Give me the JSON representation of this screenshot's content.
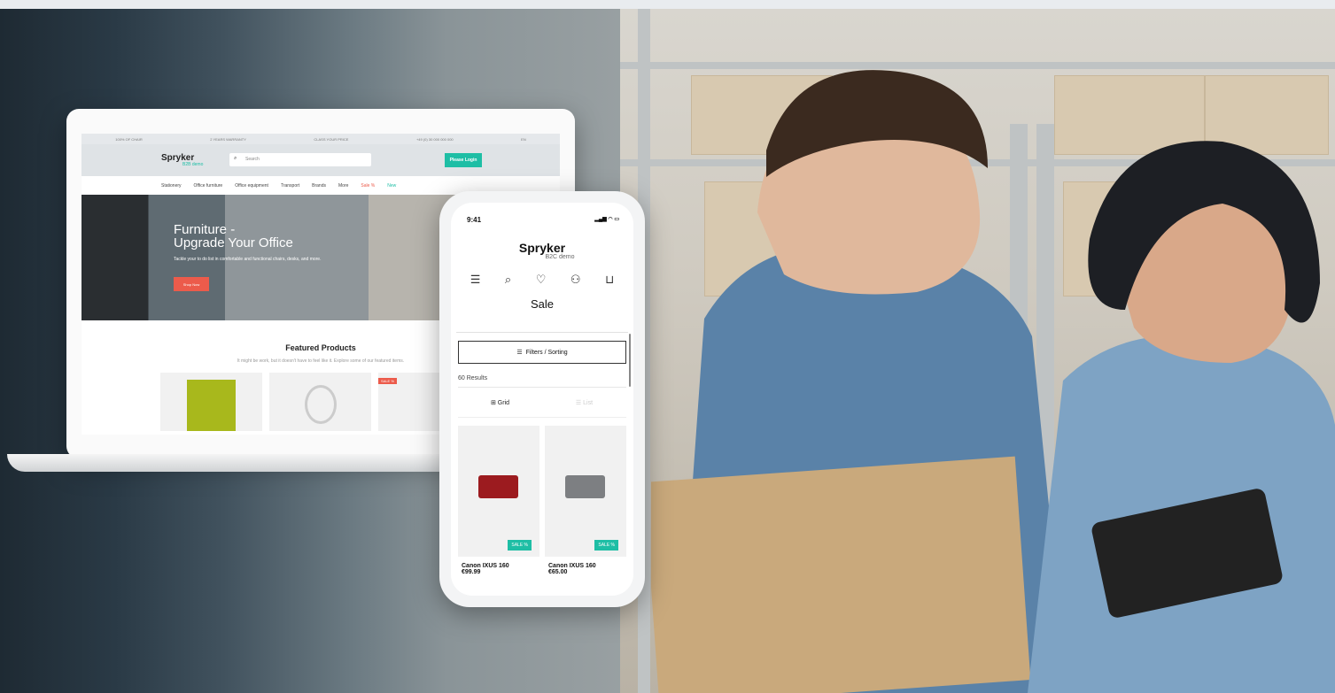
{
  "laptop": {
    "topbar": [
      "100% OF CHAIR",
      "2 YEARS WARRANTY",
      "CLASS YOUR PRICE",
      "+49 (0) 30 000 000 000",
      "EN"
    ],
    "logo": "Spryker",
    "logo_sub": "B2B demo",
    "search_placeholder": "Search",
    "login_button": "Please Login",
    "nav": [
      "Stationery",
      "Office furniture",
      "Office equipment",
      "Transport",
      "Brands",
      "More",
      "Sale %",
      "New"
    ],
    "hero_title_1": "Furniture -",
    "hero_title_2": "Upgrade Your Office",
    "hero_text": "Tackle your to do list in comfortable and functional chairs, desks, and more.",
    "hero_button": "Shop Now",
    "featured_title": "Featured Products",
    "featured_sub": "It might be work, but it doesn't have to feel like it. Explore some of our featured items.",
    "sale_badge": "SALE %"
  },
  "phone": {
    "time": "9:41",
    "logo": "Spryker",
    "logo_sub": "B2C demo",
    "title": "Sale",
    "filter_button": "Filters / Sorting",
    "results": "60 Results",
    "view_grid": "Grid",
    "view_list": "List",
    "products": [
      {
        "name": "Canon IXUS 160",
        "price": "€99.99",
        "badge": "SALE %",
        "color": "#9c1b1f"
      },
      {
        "name": "Canon IXUS 160",
        "price": "€65.00",
        "badge": "SALE %",
        "color": "#7d7f82"
      }
    ]
  },
  "colors": {
    "accent": "#1ebea5",
    "sale": "#ec5b4b"
  }
}
